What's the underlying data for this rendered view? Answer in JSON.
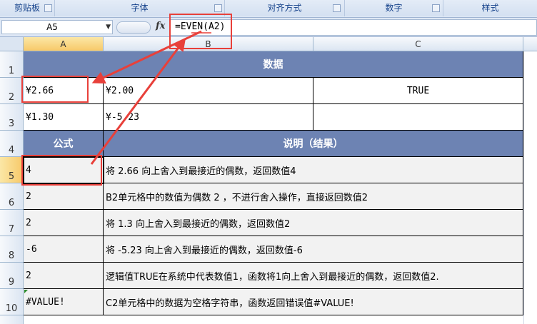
{
  "ribbon": {
    "groups": [
      "剪贴板",
      "字体",
      "对齐方式",
      "数字",
      "样式"
    ]
  },
  "formula_bar": {
    "name_box": "A5",
    "fx_label": "fx",
    "formula": "=EVEN(A2)"
  },
  "columns": [
    "A",
    "B",
    "C"
  ],
  "rows": [
    "1",
    "2",
    "3",
    "4",
    "5",
    "6",
    "7",
    "8",
    "9",
    "10"
  ],
  "sheet": {
    "data_header": "数据",
    "data": [
      [
        "¥2.66",
        "¥2.00",
        "TRUE"
      ],
      [
        "¥1.30",
        "¥-5.23",
        ""
      ]
    ],
    "formula_header": "公式",
    "desc_header": "说明（结果）",
    "results": [
      {
        "value": "4",
        "desc": "将 2.66 向上舍入到最接近的偶数，返回数值4"
      },
      {
        "value": "2",
        "desc": "B2单元格中的数值为偶数 2 ，不进行舍入操作，直接返回数值2"
      },
      {
        "value": "2",
        "desc": "将 1.3 向上舍入到最接近的偶数，返回数值2"
      },
      {
        "value": "-6",
        "desc": "将 -5.23 向上舍入到最接近的偶数，返回数值-6"
      },
      {
        "value": "2",
        "desc": "逻辑值TRUE在系统中代表数值1，函数将1向上舍入到最接近的偶数，返回数值2."
      },
      {
        "value": "#VALUE!",
        "desc": "C2单元格中的数据为空格字符串，函数返回错误值#VALUE!"
      }
    ]
  },
  "colors": {
    "header_fill": "#6d83b3",
    "annotation_red": "#e8403a",
    "ribbon_bg": "#dfe8f5"
  }
}
